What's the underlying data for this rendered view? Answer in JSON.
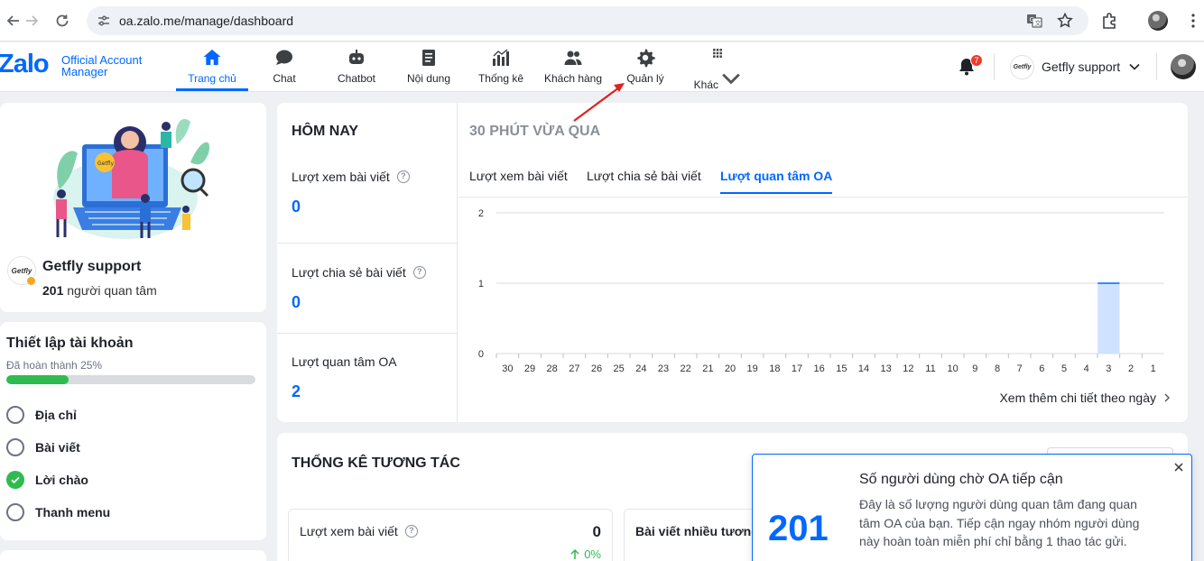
{
  "browser": {
    "url": "oa.zalo.me/manage/dashboard"
  },
  "app": {
    "logo_text": "Zalo",
    "logo_sub": [
      "Official Account",
      "Manager"
    ],
    "nav": [
      {
        "label": "Trang chủ",
        "icon": "home-icon",
        "active": true
      },
      {
        "label": "Chat",
        "icon": "chat-icon",
        "active": false
      },
      {
        "label": "Chatbot",
        "icon": "chatbot-icon",
        "active": false
      },
      {
        "label": "Nội dung",
        "icon": "content-icon",
        "active": false
      },
      {
        "label": "Thống kê",
        "icon": "statistics-icon",
        "active": false
      },
      {
        "label": "Khách hàng",
        "icon": "customers-icon",
        "active": false
      },
      {
        "label": "Quản lý",
        "icon": "gear-icon",
        "active": false
      },
      {
        "label": "Khác",
        "icon": "grid-icon",
        "active": false
      }
    ],
    "notification_count": "7",
    "account_name": "Getfly support",
    "account_logo_text": "Getfly"
  },
  "profile": {
    "name": "Getfly support",
    "follower_count": "201",
    "follower_label": " người quan tâm",
    "logo_text": "Getfly"
  },
  "setup": {
    "title": "Thiết lập tài khoản",
    "progress_label": "Đã hoàn thành 25%",
    "progress": 0.25,
    "steps": [
      {
        "label": "Địa chỉ",
        "done": false
      },
      {
        "label": "Bài viết",
        "done": false
      },
      {
        "label": "Lời chào",
        "done": true
      },
      {
        "label": "Thanh menu",
        "done": false
      }
    ]
  },
  "today": {
    "title": "HÔM NAY",
    "metrics": [
      {
        "label": "Lượt xem bài viết",
        "value": "0",
        "help": "?"
      },
      {
        "label": "Lượt chia sẻ bài viết",
        "value": "0",
        "help": "?"
      },
      {
        "label": "Lượt quan tâm OA",
        "value": "2"
      }
    ]
  },
  "recent": {
    "title": "30 PHÚT VỪA QUA",
    "tabs": [
      {
        "label": "Lượt xem bài viết",
        "active": false
      },
      {
        "label": "Lượt chia sẻ bài viết",
        "active": false
      },
      {
        "label": "Lượt quan tâm OA",
        "active": true
      }
    ],
    "more_link": "Xem thêm chi tiết theo ngày"
  },
  "chart_data": {
    "type": "bar",
    "categories": [
      "30",
      "29",
      "28",
      "27",
      "26",
      "25",
      "24",
      "23",
      "22",
      "21",
      "20",
      "19",
      "18",
      "17",
      "16",
      "15",
      "14",
      "13",
      "12",
      "11",
      "10",
      "9",
      "8",
      "7",
      "6",
      "5",
      "4",
      "3",
      "2",
      "1"
    ],
    "values": [
      0,
      0,
      0,
      0,
      0,
      0,
      0,
      0,
      0,
      0,
      0,
      0,
      0,
      0,
      0,
      0,
      0,
      0,
      0,
      0,
      0,
      0,
      0,
      0,
      0,
      0,
      0,
      1,
      0,
      0
    ],
    "ylim": [
      0,
      2
    ],
    "yticks": [
      0,
      1,
      2
    ],
    "grid": true,
    "bar_color": "#cfe2ff",
    "bar_edge_color": "#0068ff"
  },
  "interaction": {
    "title": "THỐNG KÊ TƯƠNG TÁC",
    "card1_label": "Lượt xem bài viết",
    "card1_value": "0",
    "card1_change": "0%",
    "card2_label": "Bài viết nhiều tương tác"
  },
  "popup": {
    "number": "201",
    "title": "Số người dùng chờ OA tiếp cận",
    "description": "Đây là số lượng người dùng quan tâm đang quan tâm OA của bạn. Tiếp cận ngay nhóm người dùng này hoàn toàn miễn phí chỉ bằng 1 thao tác gửi."
  },
  "colors": {
    "accent": "#0068ff",
    "success": "#2ebc4f",
    "badge": "#ef3a2c",
    "annotation_arrow": "#e02020"
  }
}
